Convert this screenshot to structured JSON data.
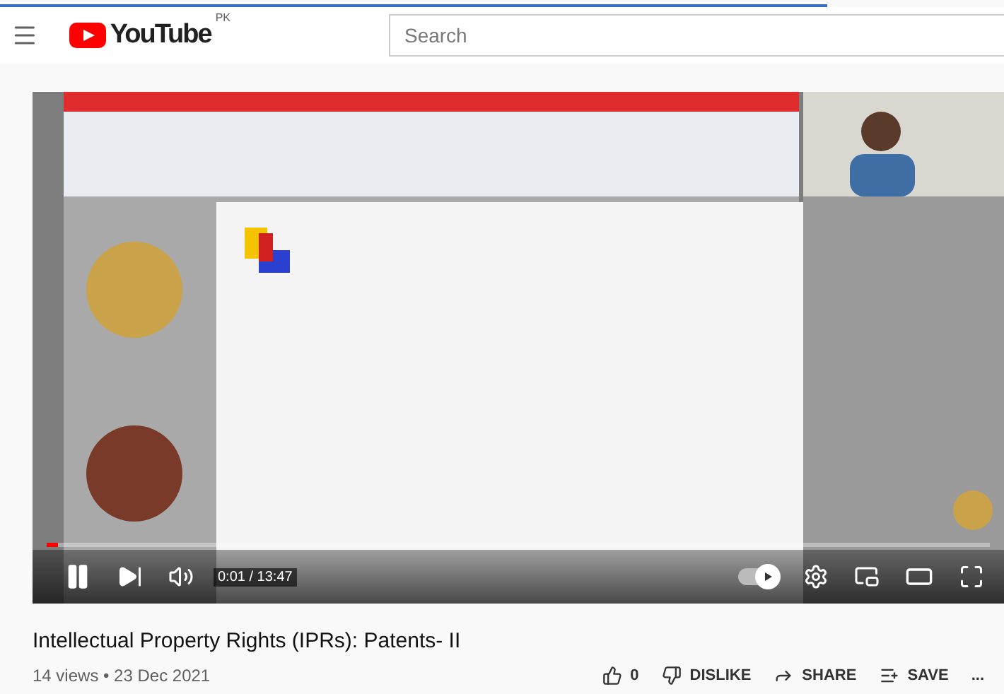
{
  "header": {
    "logo_text": "YouTube",
    "region": "PK",
    "search": {
      "placeholder": "Search"
    }
  },
  "player": {
    "progress": {
      "level": 0.012
    },
    "time": "0:01 / 13:47",
    "autoplay": {
      "on": true
    }
  },
  "video": {
    "title": "Intellectual Property Rights (IPRs): Patents- II",
    "meta": "14 views • 23 Dec 2021",
    "actions": [
      {
        "kind": "like",
        "label": "0"
      },
      {
        "kind": "dislike",
        "label": "DISLIKE"
      },
      {
        "kind": "share",
        "label": "SHARE"
      },
      {
        "kind": "save",
        "label": "SAVE"
      },
      {
        "kind": "more",
        "label": "..."
      }
    ]
  }
}
